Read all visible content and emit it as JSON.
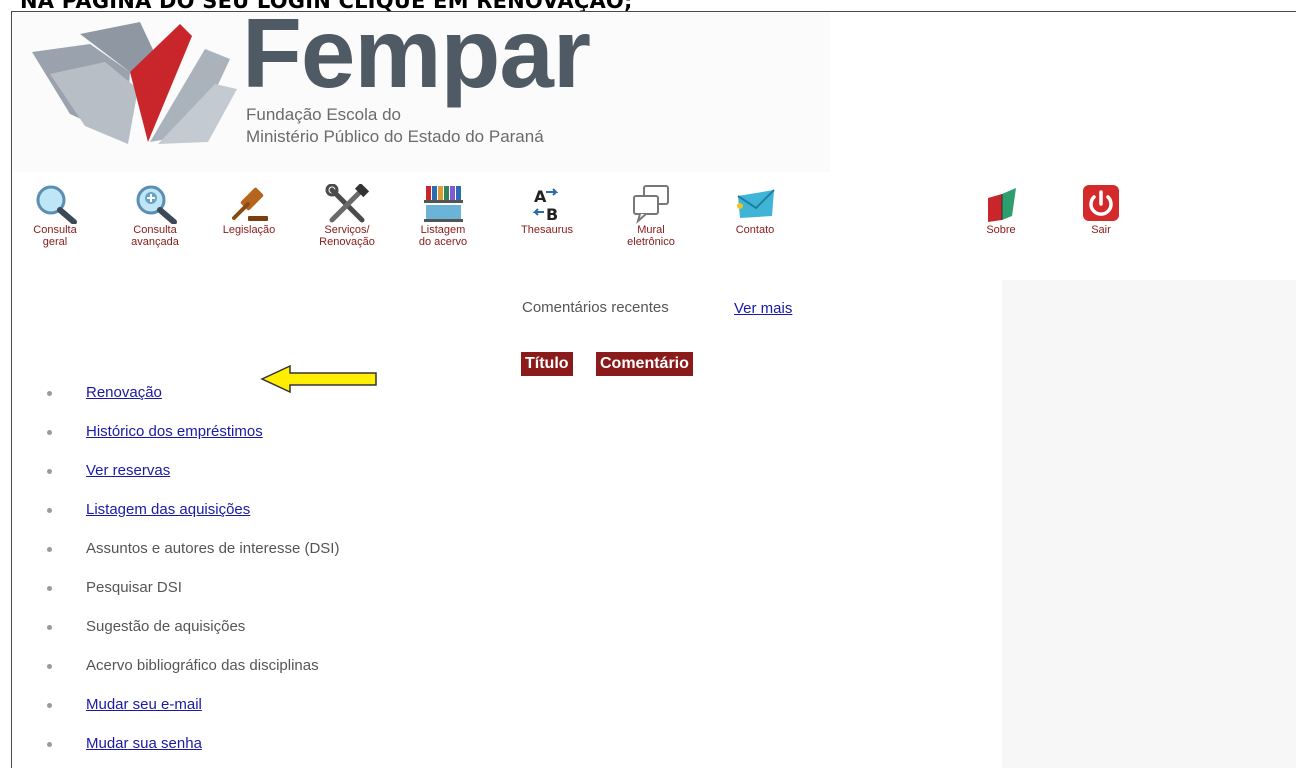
{
  "instruction": "NA PÁGINA DO SEU LOGIN CLIQUE EM RENOVAÇÃO;",
  "logo": {
    "name": "Fempar",
    "subtitle_line1": "Fundação Escola do",
    "subtitle_line2": "Ministério Público do Estado do Paraná"
  },
  "toolbar": {
    "consulta_geral_1": "Consulta",
    "consulta_geral_2": "geral",
    "consulta_avancada_1": "Consulta",
    "consulta_avancada_2": "avançada",
    "legislacao": "Legislação",
    "servicos_1": "Serviços/",
    "servicos_2": "Renovação",
    "listagem_1": "Listagem",
    "listagem_2": "do acervo",
    "thesaurus": "Thesaurus",
    "mural_1": "Mural",
    "mural_2": "eletrônico",
    "contato": "Contato",
    "sobre": "Sobre",
    "sair": "Sair"
  },
  "recent": {
    "label": "Comentários recentes",
    "link": "Ver mais",
    "col_titulo": "Título",
    "col_comentario": "Comentário"
  },
  "menu": {
    "items": [
      {
        "label": "Renovação",
        "link": true
      },
      {
        "label": "Histórico dos empréstimos",
        "link": true
      },
      {
        "label": "Ver reservas",
        "link": true
      },
      {
        "label": "Listagem das aquisições",
        "link": true
      },
      {
        "label": "Assuntos e autores de interesse (DSI)",
        "link": false
      },
      {
        "label": "Pesquisar DSI",
        "link": false
      },
      {
        "label": "Sugestão de aquisições",
        "link": false
      },
      {
        "label": "Acervo bibliográfico das disciplinas",
        "link": false
      },
      {
        "label": "Mudar seu e-mail",
        "link": true
      },
      {
        "label": "Mudar sua senha",
        "link": true
      }
    ]
  },
  "colors": {
    "accent_red": "#8b1b1b",
    "link_blue": "#1a1aa6",
    "arrow_yellow": "#ffee00"
  }
}
